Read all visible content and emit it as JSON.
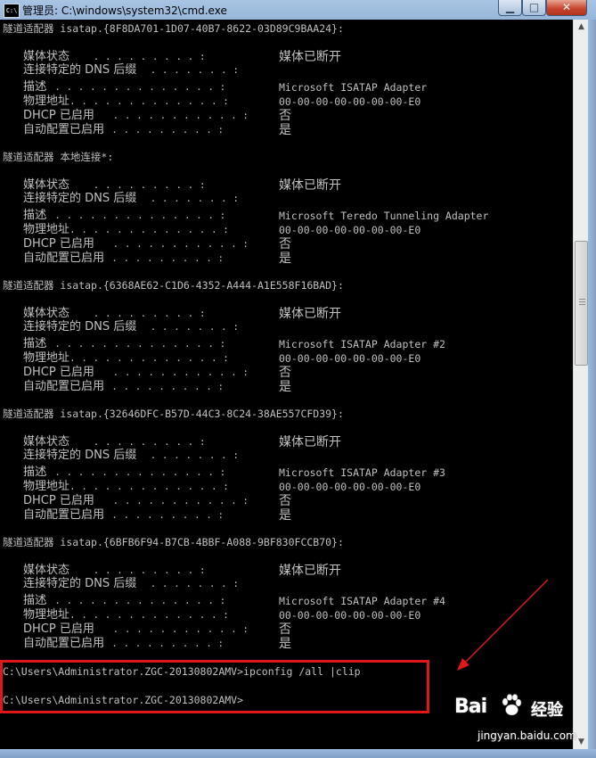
{
  "window": {
    "title": "管理员: C:\\windows\\system32\\cmd.exe",
    "app_icon_text": "C:\\",
    "minimize_glyph": "▁",
    "maximize_glyph": "□",
    "close_glyph": "✕"
  },
  "adapters": [
    {
      "header": "隧道适配器 isatap.{8F8DA701-1D07-40B7-8622-03D89C9BAA24}:",
      "props": [
        {
          "label": "媒体状态",
          "dots": " . . . . . . . . . :",
          "value": "媒体已断开"
        },
        {
          "label": "连接特定的 DNS 后缀",
          "dots": " . . . . . . . :",
          "value": ""
        },
        {
          "label": "描述",
          "dots": ". . . . . . . . . . . . . . . :",
          "value": "Microsoft ISATAP Adapter"
        },
        {
          "label": "物理地址",
          "dots": ". . . . . . . . . . . . . :",
          "value": "00-00-00-00-00-00-00-E0"
        },
        {
          "label": "DHCP 已启用",
          "dots": " . . . . . . . . . . . :",
          "value": "否"
        },
        {
          "label": "自动配置已启用",
          "dots": ". . . . . . . . . . :",
          "value": "是"
        }
      ]
    },
    {
      "header": "隧道适配器 本地连接*:",
      "props": [
        {
          "label": "媒体状态",
          "dots": " . . . . . . . . . :",
          "value": "媒体已断开"
        },
        {
          "label": "连接特定的 DNS 后缀",
          "dots": " . . . . . . . :",
          "value": ""
        },
        {
          "label": "描述",
          "dots": ". . . . . . . . . . . . . . . :",
          "value": "Microsoft Teredo Tunneling Adapter"
        },
        {
          "label": "物理地址",
          "dots": ". . . . . . . . . . . . . :",
          "value": "00-00-00-00-00-00-00-E0"
        },
        {
          "label": "DHCP 已启用",
          "dots": " . . . . . . . . . . . :",
          "value": "否"
        },
        {
          "label": "自动配置已启用",
          "dots": ". . . . . . . . . . :",
          "value": "是"
        }
      ]
    },
    {
      "header": "隧道适配器 isatap.{6368AE62-C1D6-4352-A444-A1E558F16BAD}:",
      "props": [
        {
          "label": "媒体状态",
          "dots": " . . . . . . . . . :",
          "value": "媒体已断开"
        },
        {
          "label": "连接特定的 DNS 后缀",
          "dots": " . . . . . . . :",
          "value": ""
        },
        {
          "label": "描述",
          "dots": ". . . . . . . . . . . . . . . :",
          "value": "Microsoft ISATAP Adapter #2"
        },
        {
          "label": "物理地址",
          "dots": ". . . . . . . . . . . . . :",
          "value": "00-00-00-00-00-00-00-E0"
        },
        {
          "label": "DHCP 已启用",
          "dots": " . . . . . . . . . . . :",
          "value": "否"
        },
        {
          "label": "自动配置已启用",
          "dots": ". . . . . . . . . . :",
          "value": "是"
        }
      ]
    },
    {
      "header": "隧道适配器 isatap.{32646DFC-B57D-44C3-8C24-38AE557CFD39}:",
      "props": [
        {
          "label": "媒体状态",
          "dots": " . . . . . . . . . :",
          "value": "媒体已断开"
        },
        {
          "label": "连接特定的 DNS 后缀",
          "dots": " . . . . . . . :",
          "value": ""
        },
        {
          "label": "描述",
          "dots": ". . . . . . . . . . . . . . . :",
          "value": "Microsoft ISATAP Adapter #3"
        },
        {
          "label": "物理地址",
          "dots": ". . . . . . . . . . . . . :",
          "value": "00-00-00-00-00-00-00-E0"
        },
        {
          "label": "DHCP 已启用",
          "dots": " . . . . . . . . . . . :",
          "value": "否"
        },
        {
          "label": "自动配置已启用",
          "dots": ". . . . . . . . . . :",
          "value": "是"
        }
      ]
    },
    {
      "header": "隧道适配器 isatap.{6BFB6F94-B7CB-4BBF-A088-9BF830FCCB70}:",
      "props": [
        {
          "label": "媒体状态",
          "dots": " . . . . . . . . . :",
          "value": "媒体已断开"
        },
        {
          "label": "连接特定的 DNS 后缀",
          "dots": " . . . . . . . :",
          "value": ""
        },
        {
          "label": "描述",
          "dots": ". . . . . . . . . . . . . . . :",
          "value": "Microsoft ISATAP Adapter #4"
        },
        {
          "label": "物理地址",
          "dots": ". . . . . . . . . . . . . :",
          "value": "00-00-00-00-00-00-00-E0"
        },
        {
          "label": "DHCP 已启用",
          "dots": " . . . . . . . . . . . :",
          "value": "否"
        },
        {
          "label": "自动配置已启用",
          "dots": ". . . . . . . . . . :",
          "value": "是"
        }
      ]
    }
  ],
  "commands": [
    "C:\\Users\\Administrator.ZGC-20130802AMV>ipconfig /all |clip",
    "C:\\Users\\Administrator.ZGC-20130802AMV>"
  ],
  "annotation": {
    "color": "#e01818"
  },
  "watermark": {
    "logo": "Bai",
    "cn": "经验",
    "url": "jingyan.baidu.com"
  },
  "colors": {
    "console_bg": "#000000",
    "console_fg": "#c0c0c0",
    "titlebar": "#a9c4e3"
  }
}
